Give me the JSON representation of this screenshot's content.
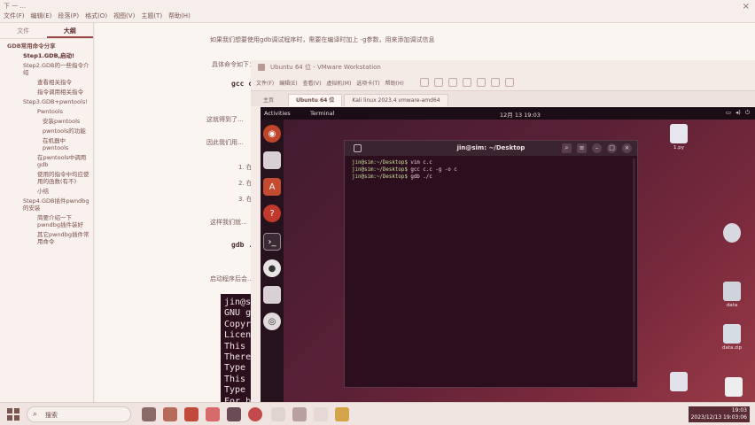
{
  "host": {
    "top_text": "下 一 ...",
    "menu": [
      "文件(F)",
      "编辑(E)",
      "段落(P)",
      "格式(O)",
      "视图(V)",
      "主题(T)",
      "帮助(H)"
    ],
    "close": "×"
  },
  "sidebar": {
    "tabs": [
      "文件",
      "大纲"
    ],
    "outline": [
      {
        "text": "GDB常用命令分享",
        "level": 0
      },
      {
        "text": "Step1.GDB,启动!",
        "level": 1,
        "bold": true
      },
      {
        "text": "Step2.GDB的一些指令介绍",
        "level": 1
      },
      {
        "text": "查看相关指令",
        "level": 2
      },
      {
        "text": "指令调用相关指令",
        "level": 2
      },
      {
        "text": "Step3.GDB+pwntools!",
        "level": 1
      },
      {
        "text": "Pwntools",
        "level": 2
      },
      {
        "text": "安装pwntools",
        "level": 3
      },
      {
        "text": "pwntools的功能",
        "level": 3
      },
      {
        "text": "在机器中pwntools",
        "level": 3
      },
      {
        "text": "在pwntools中调用gdb",
        "level": 2
      },
      {
        "text": "使用的指令中均应使用的函数(有不)",
        "level": 2
      },
      {
        "text": "小结",
        "level": 2
      },
      {
        "text": "Step4.GDB插件pwndbg的安装",
        "level": 1
      },
      {
        "text": "简要介绍一下pwndbg插件装好",
        "level": 2
      },
      {
        "text": "其它pwndbg插件常用命令",
        "level": 2
      }
    ]
  },
  "doc": {
    "lines": [
      "如果我们想要使用gdb调试程序时，需要在编译时加上 -g参数，用来添加调试信息",
      "具体命令如下：",
      "gcc c...",
      "这就得到了...",
      "因此我们用...",
      "1. 在...",
      "2. 在...",
      "3. 在...",
      "这样我们就...",
      "gdb ./...",
      "启动程序后会..."
    ],
    "terminal_lines": [
      "jin@sim",
      "GNU gdb",
      "Copyri",
      "License",
      "This i",
      "There i",
      "Type \"s",
      "This GD",
      "Type \"s",
      "For bug"
    ]
  },
  "vmware": {
    "title": "Ubuntu 64 位 - VMware Workstation",
    "menu": [
      "文件(F)",
      "编辑(E)",
      "查看(V)",
      "虚拟机(M)",
      "选项卡(T)",
      "帮助(H)"
    ],
    "home_tab": "主页",
    "tabs": [
      "Ubuntu 64 位",
      "Kali linux 2023.4 vmware-amd64"
    ]
  },
  "ubuntu": {
    "activities": "Activities",
    "app_name": "Terminal",
    "clock": "12月 13 19:03",
    "tray": [
      "▭",
      "◂)",
      "⏻"
    ]
  },
  "terminal": {
    "title": "jin@sim: ~/Desktop",
    "lines": [
      {
        "prompt": "jin@sim:~/Desktop$",
        "cmd": "vim c.c"
      },
      {
        "prompt": "jin@sim:~/Desktop$",
        "cmd": "gcc c.c -g -o c"
      },
      {
        "prompt": "jin@sim:~/Desktop$",
        "cmd": "gdb ./c"
      }
    ]
  },
  "desktop": [
    {
      "label": "1.py",
      "color": "#e6e6ee"
    },
    {
      "label": "",
      "color": "#d8d8e0"
    },
    {
      "label": "data",
      "color": "#cfd4dc"
    },
    {
      "label": "data.zip",
      "color": "#d6dce4"
    },
    {
      "label": "",
      "color": "#e2e2ea"
    },
    {
      "label": "",
      "color": "#eeeeee"
    }
  ],
  "taskbar": {
    "search_label": "搜索",
    "tray_line1": "19:03",
    "tray_line2": "2023/12/13 19:03:06"
  },
  "colors": {
    "ubuntu_bg": "#5a2036",
    "terminal_bg": "#2c0e1e",
    "prompt": "#c7e59a"
  }
}
